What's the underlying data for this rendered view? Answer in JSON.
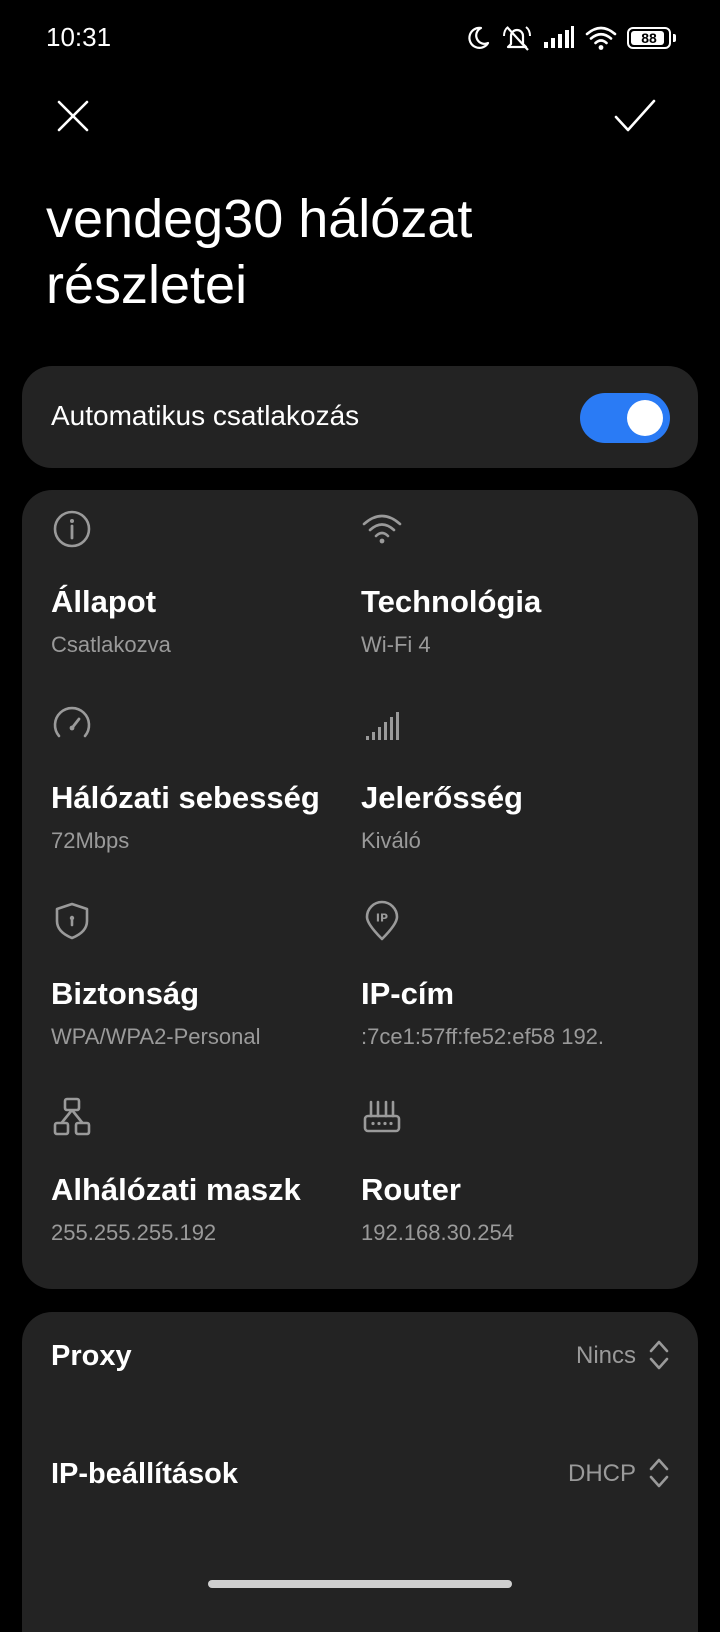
{
  "status_bar": {
    "time": "10:31",
    "battery": "88",
    "battery_level_percent": 88,
    "icons": [
      "moon-icon",
      "silent-icon",
      "cellular-signal-icon",
      "wifi-icon",
      "battery-icon"
    ]
  },
  "header": {
    "close_icon": "close-icon",
    "confirm_icon": "check-icon",
    "title": "vendeg30 hálózat részletei"
  },
  "auto_connect": {
    "label": "Automatikus csatlakozás",
    "enabled": true,
    "accent_color": "#2a7bf5"
  },
  "details": [
    {
      "icon": "info-icon",
      "label": "Állapot",
      "value": "Csatlakozva"
    },
    {
      "icon": "wifi-icon",
      "label": "Technológia",
      "value": "Wi-Fi 4"
    },
    {
      "icon": "speedometer-icon",
      "label": "Hálózati sebesség",
      "value": "72Mbps"
    },
    {
      "icon": "signal-strength-icon",
      "label": "Jelerősség",
      "value": "Kiváló"
    },
    {
      "icon": "shield-icon",
      "label": "Biztonság",
      "value": "WPA/WPA2-Personal"
    },
    {
      "icon": "ip-location-icon",
      "label": "IP-cím",
      "value": ":7ce1:57ff:fe52:ef58 192."
    },
    {
      "icon": "network-tree-icon",
      "label": "Alhálózati maszk",
      "value": "255.255.255.192"
    },
    {
      "icon": "router-icon",
      "label": "Router",
      "value": "192.168.30.254"
    }
  ],
  "settings": [
    {
      "label": "Proxy",
      "value": "Nincs",
      "icon": "chevron-updown-icon"
    },
    {
      "label": "IP-beállítások",
      "value": "DHCP",
      "icon": "chevron-updown-icon"
    }
  ]
}
